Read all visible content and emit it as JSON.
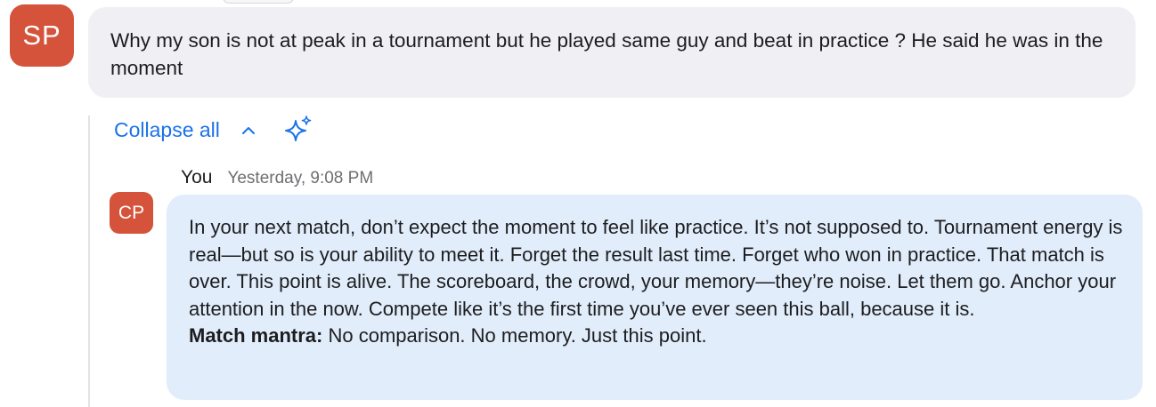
{
  "question": {
    "avatar_initials": "SP",
    "text": "Why my son is not at peak in a tournament but he played same guy and beat in practice ? He said he was in the moment"
  },
  "thread": {
    "collapse_label": "Collapse all",
    "chevron_icon": "chevron-up-icon",
    "sparkle_icon": "sparkle-icon"
  },
  "reply": {
    "avatar_initials": "CP",
    "author": "You",
    "timestamp": "Yesterday, 9:08 PM",
    "body": "In your next match, don’t expect the moment to feel like practice. It’s not supposed to. Tournament energy is real—but so is your ability to meet it. Forget the result last time. Forget who won in practice. That match is over. This point is alive. The scoreboard, the crowd, your memory—they’re noise. Let them go. Anchor your attention in the now. Compete like it’s the first time you’ve ever seen this ball, because it is.",
    "mantra_label": "Match mantra:",
    "mantra_text": " No comparison. No memory. Just this point."
  },
  "colors": {
    "avatar_bg": "#d4533a",
    "accent_blue": "#1a73e8",
    "question_bubble": "#f0f0f4",
    "reply_bubble": "#e1edfb"
  }
}
